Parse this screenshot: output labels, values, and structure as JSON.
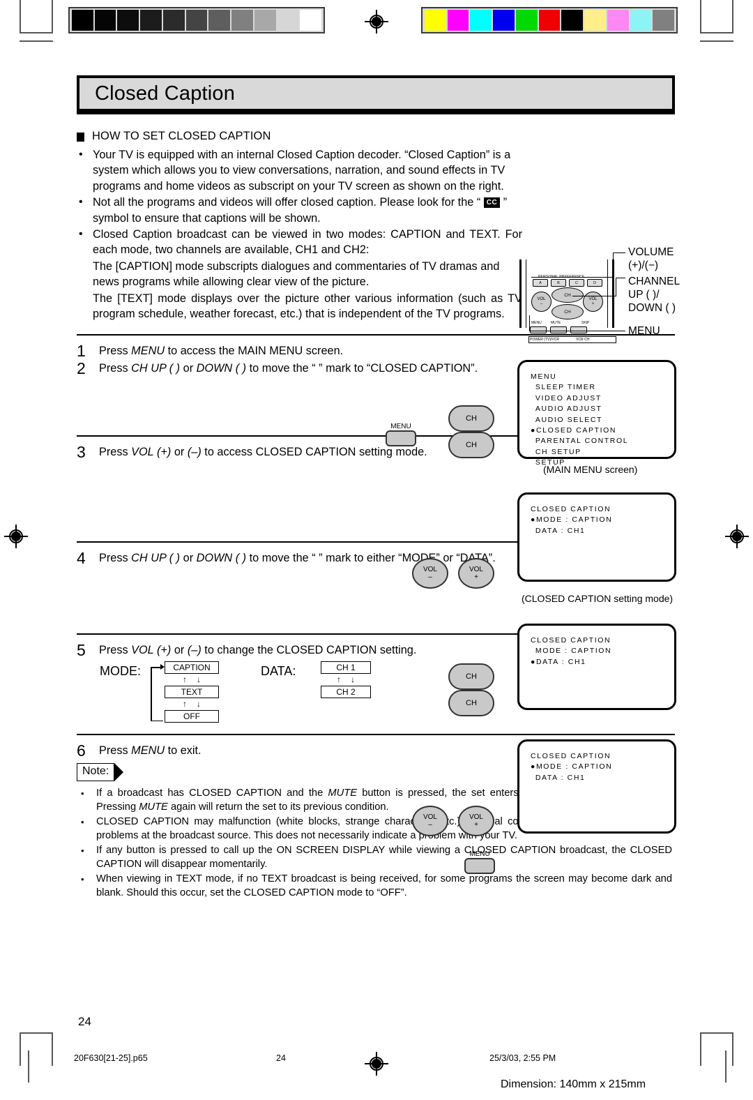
{
  "chapter": {
    "title": "Closed Caption"
  },
  "section": {
    "heading": "HOW TO SET CLOSED CAPTION"
  },
  "intro_bullets": [
    "Your TV is equipped with an internal Closed Caption decoder. “Closed Caption” is a system which allows you to view conversations, narration, and sound effects in TV programs and home videos as subscript on your TV screen as shown on the right.",
    "Not all the programs and videos will offer closed caption. Please look for the “ CC ” symbol to ensure that captions will be shown.",
    "Closed Caption broadcast can be viewed in two modes: CAPTION and TEXT. For each mode, two channels are available, CH1 and CH2:"
  ],
  "cc_symbol_label": "CC",
  "intro_paragraphs": [
    "The [CAPTION] mode subscripts dialogues and commentaries of TV dramas and news programs while allowing clear view of the picture.",
    "The [TEXT] mode displays over the picture other various information (such as TV program schedule, weather forecast, etc.) that is independent of the TV programs."
  ],
  "remote_figure": {
    "personal_preference_label": "PERSONAL PREFERENCE",
    "preference_keys": [
      "A",
      "B",
      "C",
      "D"
    ],
    "vol_minus": {
      "line1": "VOL",
      "line2": "–"
    },
    "vol_plus": {
      "line1": "VOL",
      "line2": "+"
    },
    "ch_up": "CH",
    "ch_down": "CH",
    "bottom_labels": [
      "MENU",
      "MUTE",
      "SKIP",
      "POWER (TV)/VCR",
      "VCR·CH"
    ],
    "callouts": [
      {
        "line1": "VOLUME",
        "line2": "(+)/(−)"
      },
      {
        "line1": "CHANNEL",
        "line2": "UP (   )/",
        "line3": "DOWN (   )"
      },
      {
        "line1": "MENU"
      }
    ]
  },
  "steps": [
    {
      "number": "1",
      "text_parts": [
        {
          "t": "Press ",
          "i": false
        },
        {
          "t": "MENU",
          "i": true
        },
        {
          "t": " to access the MAIN MENU screen.",
          "i": false
        }
      ]
    },
    {
      "number": "2",
      "text_parts": [
        {
          "t": "Press ",
          "i": false
        },
        {
          "t": "CH UP (   )",
          "i": true
        },
        {
          "t": " or ",
          "i": false
        },
        {
          "t": "DOWN (   )",
          "i": true
        },
        {
          "t": " to move the “   ” mark to “CLOSED CAPTION”.",
          "i": false
        }
      ]
    },
    {
      "number": "3",
      "text_parts": [
        {
          "t": "Press ",
          "i": false
        },
        {
          "t": "VOL (+)",
          "i": true
        },
        {
          "t": " or ",
          "i": false
        },
        {
          "t": "(–)",
          "i": true
        },
        {
          "t": " to access CLOSED CAPTION setting mode.",
          "i": false
        }
      ]
    },
    {
      "number": "4",
      "text_parts": [
        {
          "t": "Press ",
          "i": false
        },
        {
          "t": "CH UP (   )",
          "i": true
        },
        {
          "t": " or ",
          "i": false
        },
        {
          "t": "DOWN (   )",
          "i": true
        },
        {
          "t": " to move the “   ” mark to either “MODE” or “DATA”.",
          "i": false
        }
      ]
    },
    {
      "number": "5",
      "text_parts": [
        {
          "t": "Press ",
          "i": false
        },
        {
          "t": "VOL (+)",
          "i": true
        },
        {
          "t": " or ",
          "i": false
        },
        {
          "t": "(–)",
          "i": true
        },
        {
          "t": " to change the CLOSED CAPTION setting.",
          "i": false
        }
      ]
    },
    {
      "number": "6",
      "text_parts": [
        {
          "t": "Press ",
          "i": false
        },
        {
          "t": "MENU",
          "i": true
        },
        {
          "t": " to exit.",
          "i": false
        }
      ]
    }
  ],
  "step5_flow": {
    "mode_label": "MODE:",
    "mode_options": [
      "CAPTION",
      "TEXT",
      "OFF"
    ],
    "data_label": "DATA:",
    "data_options": [
      "CH 1",
      "CH 2"
    ]
  },
  "remote_keys": {
    "menu_label": "MENU",
    "ch_label": "CH",
    "vol_minus_l1": "VOL",
    "vol_minus_l2": "–",
    "vol_plus_l1": "VOL",
    "vol_plus_l2": "+"
  },
  "osd_screens": [
    {
      "name": "main-menu",
      "lines": [
        {
          "text": "MENU",
          "marker": false,
          "indent": 0
        },
        {
          "text": "SLEEP TIMER",
          "marker": false,
          "indent": 1
        },
        {
          "text": "VIDEO ADJUST",
          "marker": false,
          "indent": 1
        },
        {
          "text": "AUDIO ADJUST",
          "marker": false,
          "indent": 1
        },
        {
          "text": "AUDIO SELECT",
          "marker": false,
          "indent": 1
        },
        {
          "text": "CLOSED CAPTION",
          "marker": true,
          "indent": 0
        },
        {
          "text": "PARENTAL CONTROL",
          "marker": false,
          "indent": 1
        },
        {
          "text": "CH SETUP",
          "marker": false,
          "indent": 1
        },
        {
          "text": "SETUP",
          "marker": false,
          "indent": 1
        }
      ],
      "caption": "(MAIN MENU screen)"
    },
    {
      "name": "cc-setting-mode",
      "lines": [
        {
          "text": "CLOSED CAPTION",
          "marker": false,
          "indent": 0
        },
        {
          "text": "",
          "marker": false,
          "indent": 0
        },
        {
          "text": "MODE : CAPTION",
          "marker": true,
          "indent": 0
        },
        {
          "text": "DATA : CH1",
          "marker": false,
          "indent": 1
        }
      ],
      "caption": "(CLOSED CAPTION setting mode)"
    },
    {
      "name": "cc-data-selected",
      "lines": [
        {
          "text": "CLOSED CAPTION",
          "marker": false,
          "indent": 0
        },
        {
          "text": "",
          "marker": false,
          "indent": 0
        },
        {
          "text": "MODE : CAPTION",
          "marker": false,
          "indent": 1
        },
        {
          "text": "DATA : CH1",
          "marker": true,
          "indent": 0
        }
      ],
      "caption": ""
    },
    {
      "name": "cc-mode-selected",
      "lines": [
        {
          "text": "CLOSED CAPTION",
          "marker": false,
          "indent": 0
        },
        {
          "text": "",
          "marker": false,
          "indent": 0
        },
        {
          "text": "MODE : CAPTION",
          "marker": true,
          "indent": 0
        },
        {
          "text": "DATA : CH1",
          "marker": false,
          "indent": 1
        }
      ],
      "caption": ""
    }
  ],
  "note": {
    "label": "Note:",
    "items": [
      "If a broadcast has CLOSED CAPTION and the MUTE button is pressed, the set enters [CAPTION] mode automatically. Pressing MUTE again will return the set to its previous condition.",
      "CLOSED CAPTION may malfunction (white blocks, strange characters, etc.) if signal conditions are poor or if there are problems at the broadcast source. This does not necessarily indicate a problem with your TV.",
      "If any button is pressed to call up the ON SCREEN DISPLAY while viewing a CLOSED CAPTION broadcast, the CLOSED CAPTION will disappear momentarily.",
      "When viewing in TEXT mode, if no TEXT broadcast is being received, for some programs the screen may become dark and blank. Should this occur, set the CLOSED CAPTION mode to “OFF”."
    ]
  },
  "page_number": "24",
  "footer": {
    "filename": "20F630[21-25].p65",
    "page": "24",
    "timestamp": "25/3/03, 2:55 PM",
    "dimension": "Dimension: 140mm x 215mm"
  },
  "calibration": {
    "gray_wedge": [
      "#000000",
      "#050505",
      "#0d0d0d",
      "#1c1c1c",
      "#2b2b2b",
      "#444444",
      "#5e5e5e",
      "#808080",
      "#a8a8a8",
      "#d6d6d6",
      "#ffffff"
    ],
    "color_bars": [
      "#ffff00",
      "#ff00ff",
      "#00ffff",
      "#0000ee",
      "#00d900",
      "#ee0000",
      "#000000",
      "#ffef88",
      "#ff88f5",
      "#8cf4f7",
      "#808080"
    ]
  }
}
